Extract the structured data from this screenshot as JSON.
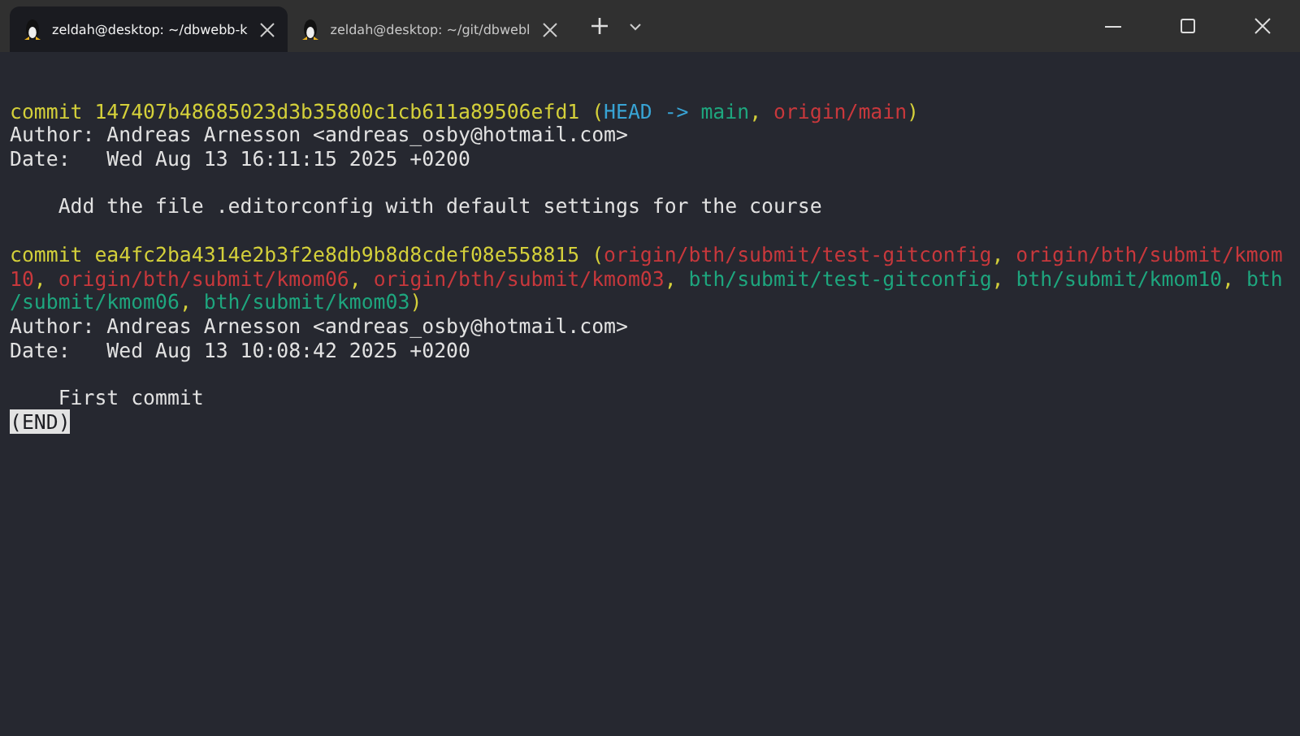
{
  "tabs": [
    {
      "label": "zeldah@desktop: ~/dbwebb-k",
      "selected": true
    },
    {
      "label": "zeldah@desktop: ~/git/dbwebl",
      "selected": false
    }
  ],
  "terminal": {
    "lines": [
      {
        "kind": "blank"
      },
      {
        "kind": "text",
        "segments": [
          {
            "text": "commit 147407b48685023d3b35800c1cb611a89506efd1 (",
            "color": "#d4d03a"
          },
          {
            "text": "HEAD -> ",
            "color": "#38a3d4"
          },
          {
            "text": "main",
            "color": "#1ea67e"
          },
          {
            "text": ", ",
            "color": "#d4d03a"
          },
          {
            "text": "origin/main",
            "color": "#c8383c"
          },
          {
            "text": ")",
            "color": "#d4d03a"
          }
        ]
      },
      {
        "kind": "text",
        "segments": [
          {
            "text": "Author: Andreas Arnesson <andreas_osby@hotmail.com>",
            "color": "#e2e2e2"
          }
        ]
      },
      {
        "kind": "text",
        "segments": [
          {
            "text": "Date:   Wed Aug 13 16:11:15 2025 +0200",
            "color": "#e2e2e2"
          }
        ]
      },
      {
        "kind": "blank"
      },
      {
        "kind": "text",
        "segments": [
          {
            "text": "    Add the file .editorconfig with default settings for the course",
            "color": "#e2e2e2"
          }
        ]
      },
      {
        "kind": "blank"
      },
      {
        "kind": "text",
        "segments": [
          {
            "text": "commit ea4fc2ba4314e2b3f2e8db9b8d8cdef08e558815 (",
            "color": "#d4d03a"
          },
          {
            "text": "origin/bth/submit/test-gitconfig",
            "color": "#c8383c"
          },
          {
            "text": ", ",
            "color": "#d4d03a"
          },
          {
            "text": "origin/bth/submit/kmom",
            "color": "#c8383c"
          }
        ]
      },
      {
        "kind": "text",
        "segments": [
          {
            "text": "10",
            "color": "#c8383c"
          },
          {
            "text": ", ",
            "color": "#d4d03a"
          },
          {
            "text": "origin/bth/submit/kmom06",
            "color": "#c8383c"
          },
          {
            "text": ", ",
            "color": "#d4d03a"
          },
          {
            "text": "origin/bth/submit/kmom03",
            "color": "#c8383c"
          },
          {
            "text": ", ",
            "color": "#d4d03a"
          },
          {
            "text": "bth/submit/test-gitconfig",
            "color": "#1ea67e"
          },
          {
            "text": ", ",
            "color": "#d4d03a"
          },
          {
            "text": "bth/submit/kmom10",
            "color": "#1ea67e"
          },
          {
            "text": ", ",
            "color": "#d4d03a"
          },
          {
            "text": "bth",
            "color": "#1ea67e"
          }
        ]
      },
      {
        "kind": "text",
        "segments": [
          {
            "text": "/submit/kmom06",
            "color": "#1ea67e"
          },
          {
            "text": ", ",
            "color": "#d4d03a"
          },
          {
            "text": "bth/submit/kmom03",
            "color": "#1ea67e"
          },
          {
            "text": ")",
            "color": "#d4d03a"
          }
        ]
      },
      {
        "kind": "text",
        "segments": [
          {
            "text": "Author: Andreas Arnesson <andreas_osby@hotmail.com>",
            "color": "#e2e2e2"
          }
        ]
      },
      {
        "kind": "text",
        "segments": [
          {
            "text": "Date:   Wed Aug 13 10:08:42 2025 +0200",
            "color": "#e2e2e2"
          }
        ]
      },
      {
        "kind": "blank"
      },
      {
        "kind": "text",
        "segments": [
          {
            "text": "    First commit",
            "color": "#e2e2e2"
          }
        ]
      },
      {
        "kind": "text",
        "segments": [
          {
            "text": "(END)",
            "color": "#e2e2e2",
            "inverse": true
          }
        ]
      }
    ]
  }
}
